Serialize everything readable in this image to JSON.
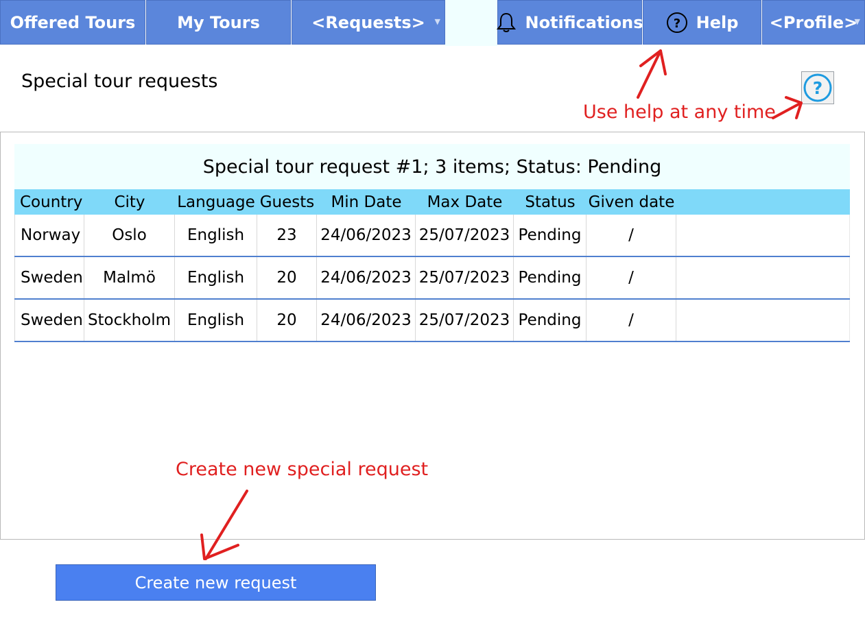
{
  "nav": {
    "offered_tours": "Offered Tours",
    "my_tours": "My Tours",
    "requests": "<Requests>",
    "notifications": "Notifications",
    "help": "Help",
    "profile": "<Profile>"
  },
  "page": {
    "title": "Special tour requests"
  },
  "annotations": {
    "help_hint": "Use help at any time",
    "create_hint": "Create new special request"
  },
  "request": {
    "title": "Special tour request #1; 3 items; Status: Pending",
    "columns": [
      "Country",
      "City",
      "Language",
      "Guests",
      "Min Date",
      "Max Date",
      "Status",
      "Given date"
    ],
    "rows": [
      [
        "Norway",
        "Oslo",
        "English",
        "23",
        "24/06/2023",
        "25/07/2023",
        "Pending",
        "/"
      ],
      [
        "Sweden",
        "Malmö",
        "English",
        "20",
        "24/06/2023",
        "25/07/2023",
        "Pending",
        "/"
      ],
      [
        "Sweden",
        "Stockholm",
        "English",
        "20",
        "24/06/2023",
        "25/07/2023",
        "Pending",
        "/"
      ]
    ]
  },
  "actions": {
    "create_request": "Create new request"
  },
  "colors": {
    "nav_bg": "#5b86db",
    "title_bg": "#f0ffff",
    "header_bg": "#7fd9f9",
    "button_bg": "#4a80f0",
    "annotation": "#e02020",
    "help_icon": "#1e9be0"
  },
  "icons": {
    "notifications": "bell-icon",
    "help": "question-circle-icon",
    "help_button": "question-circle-icon",
    "dropdown": "chevron-down-icon"
  }
}
